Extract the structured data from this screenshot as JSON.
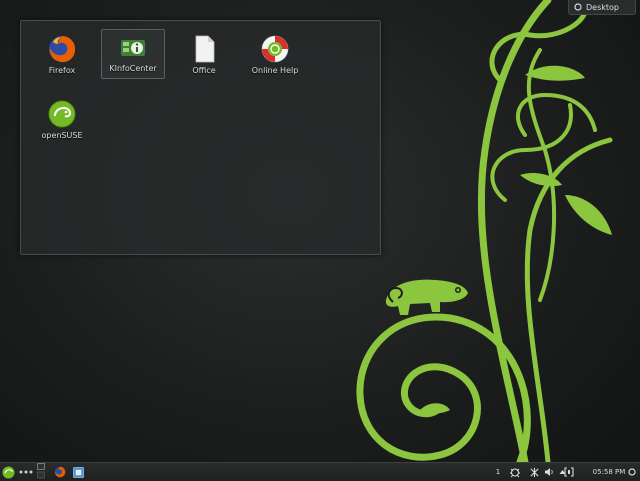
{
  "desktop_icons": [
    {
      "label": "Firefox",
      "icon": "firefox-icon",
      "selected": false
    },
    {
      "label": "KInfoCenter",
      "icon": "kinfocenter-icon",
      "selected": true
    },
    {
      "label": "Office",
      "icon": "office-document-icon",
      "selected": false
    },
    {
      "label": "Online Help",
      "icon": "help-lifebuoy-icon",
      "selected": false
    },
    {
      "label": "openSUSE",
      "icon": "opensuse-icon",
      "selected": false
    }
  ],
  "desktop_toolbox": {
    "label": "Desktop"
  },
  "taskbar": {
    "pager_number": "1",
    "clock": "05:58 PM"
  },
  "colors": {
    "opensuse_green": "#73ba25",
    "firefox_orange": "#e66000",
    "firefox_blue": "#2c4ba5"
  }
}
